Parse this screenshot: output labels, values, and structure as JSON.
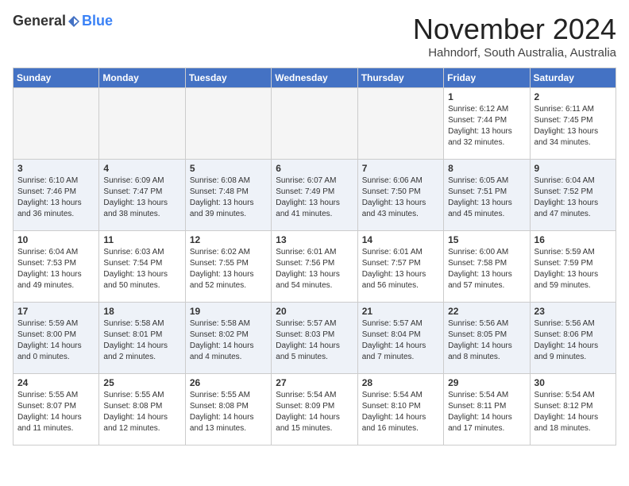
{
  "header": {
    "logo_general": "General",
    "logo_blue": "Blue",
    "month": "November 2024",
    "location": "Hahndorf, South Australia, Australia"
  },
  "calendar": {
    "headers": [
      "Sunday",
      "Monday",
      "Tuesday",
      "Wednesday",
      "Thursday",
      "Friday",
      "Saturday"
    ],
    "weeks": [
      [
        {
          "day": "",
          "info": ""
        },
        {
          "day": "",
          "info": ""
        },
        {
          "day": "",
          "info": ""
        },
        {
          "day": "",
          "info": ""
        },
        {
          "day": "",
          "info": ""
        },
        {
          "day": "1",
          "info": "Sunrise: 6:12 AM\nSunset: 7:44 PM\nDaylight: 13 hours\nand 32 minutes."
        },
        {
          "day": "2",
          "info": "Sunrise: 6:11 AM\nSunset: 7:45 PM\nDaylight: 13 hours\nand 34 minutes."
        }
      ],
      [
        {
          "day": "3",
          "info": "Sunrise: 6:10 AM\nSunset: 7:46 PM\nDaylight: 13 hours\nand 36 minutes."
        },
        {
          "day": "4",
          "info": "Sunrise: 6:09 AM\nSunset: 7:47 PM\nDaylight: 13 hours\nand 38 minutes."
        },
        {
          "day": "5",
          "info": "Sunrise: 6:08 AM\nSunset: 7:48 PM\nDaylight: 13 hours\nand 39 minutes."
        },
        {
          "day": "6",
          "info": "Sunrise: 6:07 AM\nSunset: 7:49 PM\nDaylight: 13 hours\nand 41 minutes."
        },
        {
          "day": "7",
          "info": "Sunrise: 6:06 AM\nSunset: 7:50 PM\nDaylight: 13 hours\nand 43 minutes."
        },
        {
          "day": "8",
          "info": "Sunrise: 6:05 AM\nSunset: 7:51 PM\nDaylight: 13 hours\nand 45 minutes."
        },
        {
          "day": "9",
          "info": "Sunrise: 6:04 AM\nSunset: 7:52 PM\nDaylight: 13 hours\nand 47 minutes."
        }
      ],
      [
        {
          "day": "10",
          "info": "Sunrise: 6:04 AM\nSunset: 7:53 PM\nDaylight: 13 hours\nand 49 minutes."
        },
        {
          "day": "11",
          "info": "Sunrise: 6:03 AM\nSunset: 7:54 PM\nDaylight: 13 hours\nand 50 minutes."
        },
        {
          "day": "12",
          "info": "Sunrise: 6:02 AM\nSunset: 7:55 PM\nDaylight: 13 hours\nand 52 minutes."
        },
        {
          "day": "13",
          "info": "Sunrise: 6:01 AM\nSunset: 7:56 PM\nDaylight: 13 hours\nand 54 minutes."
        },
        {
          "day": "14",
          "info": "Sunrise: 6:01 AM\nSunset: 7:57 PM\nDaylight: 13 hours\nand 56 minutes."
        },
        {
          "day": "15",
          "info": "Sunrise: 6:00 AM\nSunset: 7:58 PM\nDaylight: 13 hours\nand 57 minutes."
        },
        {
          "day": "16",
          "info": "Sunrise: 5:59 AM\nSunset: 7:59 PM\nDaylight: 13 hours\nand 59 minutes."
        }
      ],
      [
        {
          "day": "17",
          "info": "Sunrise: 5:59 AM\nSunset: 8:00 PM\nDaylight: 14 hours\nand 0 minutes."
        },
        {
          "day": "18",
          "info": "Sunrise: 5:58 AM\nSunset: 8:01 PM\nDaylight: 14 hours\nand 2 minutes."
        },
        {
          "day": "19",
          "info": "Sunrise: 5:58 AM\nSunset: 8:02 PM\nDaylight: 14 hours\nand 4 minutes."
        },
        {
          "day": "20",
          "info": "Sunrise: 5:57 AM\nSunset: 8:03 PM\nDaylight: 14 hours\nand 5 minutes."
        },
        {
          "day": "21",
          "info": "Sunrise: 5:57 AM\nSunset: 8:04 PM\nDaylight: 14 hours\nand 7 minutes."
        },
        {
          "day": "22",
          "info": "Sunrise: 5:56 AM\nSunset: 8:05 PM\nDaylight: 14 hours\nand 8 minutes."
        },
        {
          "day": "23",
          "info": "Sunrise: 5:56 AM\nSunset: 8:06 PM\nDaylight: 14 hours\nand 9 minutes."
        }
      ],
      [
        {
          "day": "24",
          "info": "Sunrise: 5:55 AM\nSunset: 8:07 PM\nDaylight: 14 hours\nand 11 minutes."
        },
        {
          "day": "25",
          "info": "Sunrise: 5:55 AM\nSunset: 8:08 PM\nDaylight: 14 hours\nand 12 minutes."
        },
        {
          "day": "26",
          "info": "Sunrise: 5:55 AM\nSunset: 8:08 PM\nDaylight: 14 hours\nand 13 minutes."
        },
        {
          "day": "27",
          "info": "Sunrise: 5:54 AM\nSunset: 8:09 PM\nDaylight: 14 hours\nand 15 minutes."
        },
        {
          "day": "28",
          "info": "Sunrise: 5:54 AM\nSunset: 8:10 PM\nDaylight: 14 hours\nand 16 minutes."
        },
        {
          "day": "29",
          "info": "Sunrise: 5:54 AM\nSunset: 8:11 PM\nDaylight: 14 hours\nand 17 minutes."
        },
        {
          "day": "30",
          "info": "Sunrise: 5:54 AM\nSunset: 8:12 PM\nDaylight: 14 hours\nand 18 minutes."
        }
      ]
    ]
  }
}
